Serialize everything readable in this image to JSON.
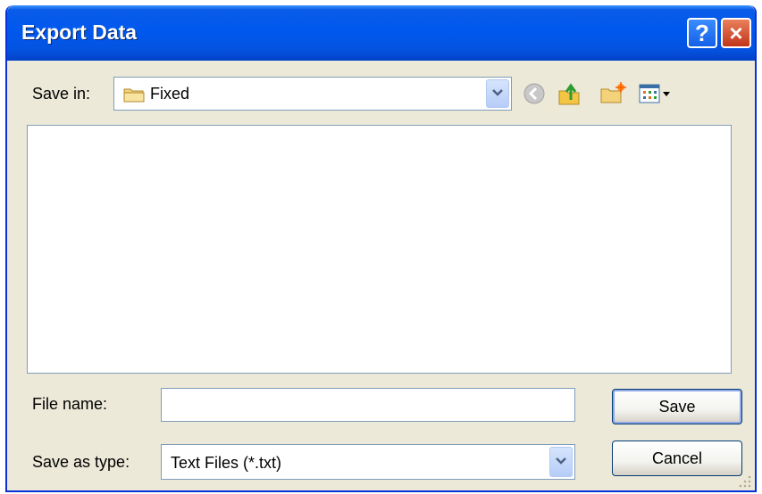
{
  "window": {
    "title": "Export Data"
  },
  "title_buttons": {
    "help": "?",
    "close": "×"
  },
  "save_in": {
    "label": "Save in:",
    "value": "Fixed"
  },
  "toolbar": {
    "icons": [
      "back-icon",
      "up-folder-icon",
      "new-folder-icon",
      "view-menu-icon"
    ]
  },
  "file_name": {
    "label": "File name:",
    "value": ""
  },
  "save_as_type": {
    "label": "Save as type:",
    "value": "Text Files (*.txt)"
  },
  "buttons": {
    "save": "Save",
    "cancel": "Cancel"
  },
  "colors": {
    "titlebar": "#0058ee",
    "window_bg": "#ece9d8",
    "close_button": "#c2351a"
  }
}
